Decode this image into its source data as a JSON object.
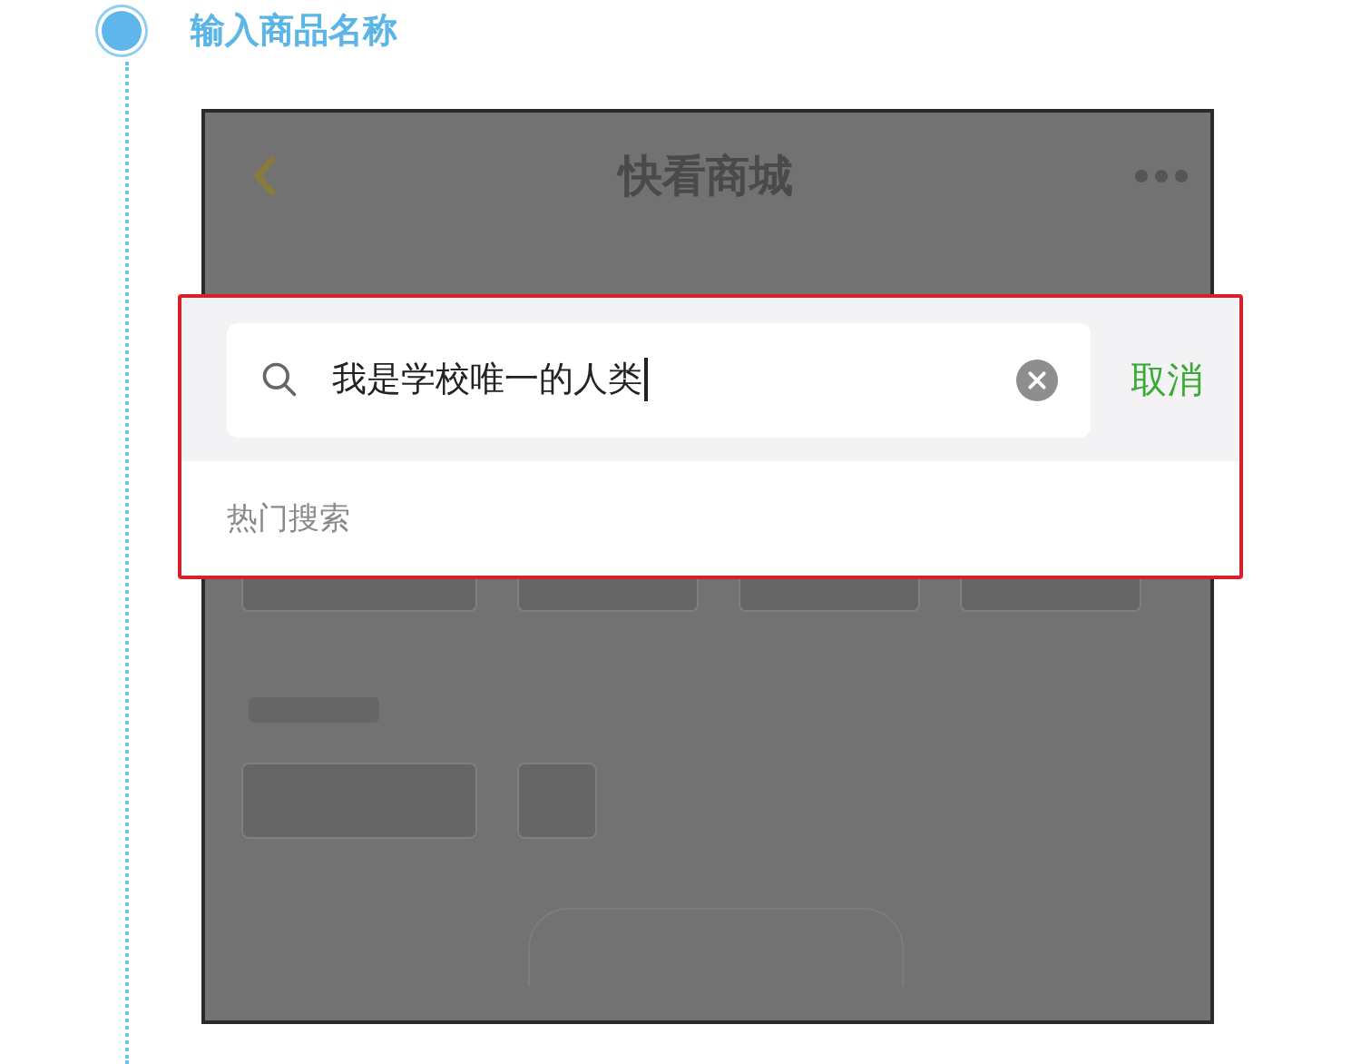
{
  "step": {
    "title": "输入商品名称"
  },
  "phone": {
    "title": "快看商城"
  },
  "search_popup": {
    "query": "我是学校唯一的人类",
    "cancel": "取消",
    "hot_label": "热门搜索"
  }
}
